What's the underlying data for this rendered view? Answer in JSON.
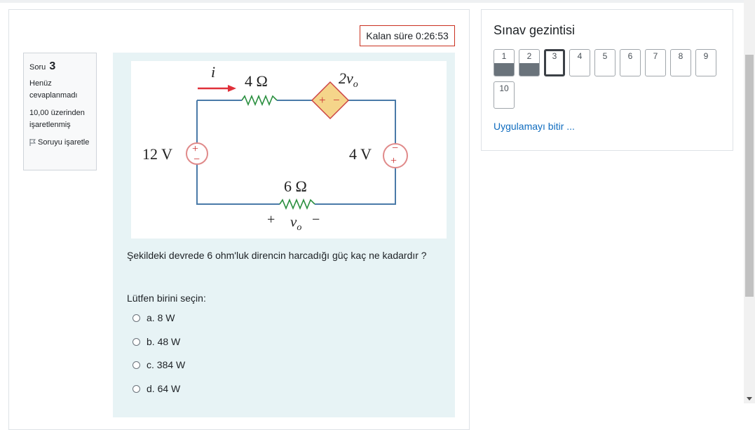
{
  "timer": {
    "label": "Kalan süre 0:26:53"
  },
  "question_info": {
    "soru_label": "Soru",
    "number": "3",
    "state": "Henüz cevaplanmadı",
    "grade": "10,00 üzerinden işaretlenmiş",
    "flag_label": "Soruyu işaretle"
  },
  "circuit": {
    "current": "i",
    "r_top": "4 Ω",
    "dep_source": "2v",
    "dep_sub": "o",
    "source_left": "12 V",
    "source_right": "4 V",
    "r_bottom": "6 Ω",
    "v_label": "v",
    "v_sub": "o",
    "plus": "+",
    "minus": "−"
  },
  "question": {
    "text": "Şekildeki devrede 6 ohm'luk direncin harcadığı güç kaç ne kadardır ?",
    "prompt": "Lütfen birini seçin:",
    "answers": [
      "a. 8 W",
      "b. 48 W",
      "c. 384 W",
      "d. 64 W"
    ]
  },
  "navigation": {
    "title": "Sınav gezintisi",
    "buttons": [
      {
        "label": "1",
        "state": "answered"
      },
      {
        "label": "2",
        "state": "answered"
      },
      {
        "label": "3",
        "state": "current"
      },
      {
        "label": "4",
        "state": "empty"
      },
      {
        "label": "5",
        "state": "empty"
      },
      {
        "label": "6",
        "state": "empty"
      },
      {
        "label": "7",
        "state": "empty"
      },
      {
        "label": "8",
        "state": "empty"
      },
      {
        "label": "9",
        "state": "empty"
      },
      {
        "label": "10",
        "state": "empty"
      }
    ],
    "finish": "Uygulamayı bitir ..."
  },
  "colors": {
    "accent": "#0f6cbf",
    "timer_border": "#ca3120",
    "question_bg": "#e7f3f5",
    "answered": "#6a737b",
    "wire": "#4a7aa8",
    "source": "#e08a8a",
    "dep_source": "#f5d58a",
    "resistor": "#2a8f3f",
    "arrow": "#e0303a"
  }
}
